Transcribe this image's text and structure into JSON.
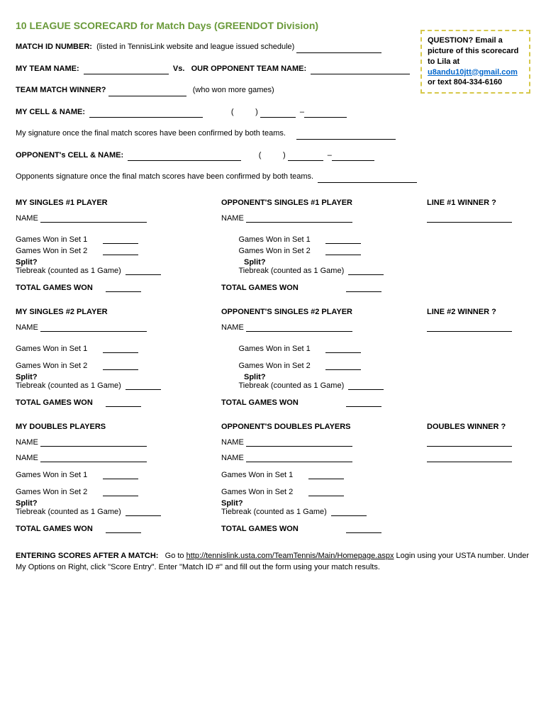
{
  "title": "10 LEAGUE SCORECARD for Match Days (GREENDOT Division)",
  "qbox": {
    "line1": "QUESTION? Email a picture of this scorecard to Lila at ",
    "email": "u8andu10jtt@gmail.com",
    "line2": " or text 804-334-6160"
  },
  "matchId": {
    "label": "MATCH ID NUMBER:",
    "hint": "(listed in TennisLink website and league issued schedule)"
  },
  "myTeam": "MY TEAM NAME:",
  "vs": "Vs.",
  "oppTeam": "OUR OPPONENT TEAM NAME:",
  "winner": {
    "label": "TEAM MATCH WINNER?",
    "hint": "(who won more games)"
  },
  "myCell": "MY CELL & NAME:",
  "mySig": "My signature once the final match scores have been confirmed by both teams.",
  "oppCell": "OPPONENT's CELL & NAME:",
  "oppSig": "Opponents signature once the final match scores have been confirmed by both teams.",
  "name": "NAME",
  "set1": "Games Won in Set 1",
  "set2": "Games Won in Set 2",
  "split": "Split?",
  "tiebreak": "Tiebreak (counted as 1 Game)",
  "total": "TOTAL GAMES WON",
  "s1": {
    "my": "MY SINGLES #1 PLAYER",
    "opp": "OPPONENT'S SINGLES #1 PLAYER",
    "win": "LINE #1 WINNER ?"
  },
  "s2": {
    "my": "MY SINGLES #2 PLAYER",
    "opp": "OPPONENT'S SINGLES #2 PLAYER",
    "win": "LINE #2 WINNER ?"
  },
  "d": {
    "my": "MY DOUBLES  PLAYERS",
    "opp": "OPPONENT'S DOUBLES PLAYERS",
    "win": "DOUBLES WINNER ?"
  },
  "entering": {
    "label": "ENTERING SCORES AFTER A MATCH:",
    "text1": "Go to ",
    "link": "http://tennislink.usta.com/TeamTennis/Main/Homepage.aspx",
    "text2": "   Login using your USTA number.  Under My Options on Right, click \"Score Entry\". Enter \"Match ID #\" and fill out the form using your match results."
  }
}
